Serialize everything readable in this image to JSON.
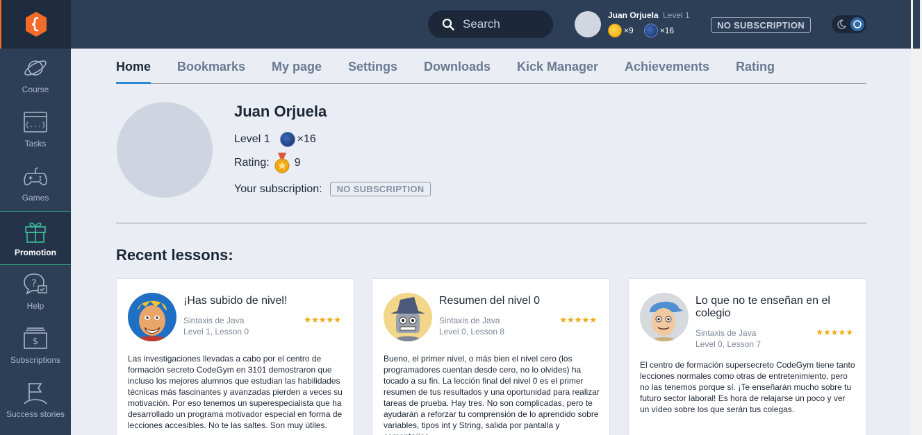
{
  "sidebar": {
    "logo": "codegym-logo",
    "items": [
      {
        "label": "Course",
        "icon": "planet-icon"
      },
      {
        "label": "Tasks",
        "icon": "code-braces-icon"
      },
      {
        "label": "Games",
        "icon": "gamepad-icon"
      },
      {
        "label": "Promotion",
        "icon": "gift-icon"
      },
      {
        "label": "Help",
        "icon": "help-chat-icon"
      },
      {
        "label": "Subscriptions",
        "icon": "dollar-bill-icon"
      },
      {
        "label": "Success stories",
        "icon": "flag-icon"
      }
    ]
  },
  "header": {
    "search_placeholder": "Search",
    "user_name": "Juan Orjuela",
    "user_level": "Level 1",
    "gold_count": "×9",
    "dark_count": "×16",
    "subscription_badge": "NO SUBSCRIPTION"
  },
  "tabs": [
    "Home",
    "Bookmarks",
    "My page",
    "Settings",
    "Downloads",
    "Kick Manager",
    "Achievements",
    "Rating"
  ],
  "profile": {
    "name": "Juan Orjuela",
    "level_label": "Level 1",
    "dark_count": "×16",
    "rating_label": "Rating:",
    "rating_value": "9",
    "subscription_label": "Your subscription:",
    "subscription_value": "NO SUBSCRIPTION"
  },
  "recent_title": "Recent lessons:",
  "lessons": [
    {
      "title": "¡Has subido de nivel!",
      "course": "Sintaxis de Java",
      "lesson": "Level 1, Lesson 0",
      "rating": 4.5,
      "stars": "★★★★★",
      "body": "Las investigaciones llevadas a cabo por el centro de formación secreto CodeGym en 3101 demostraron que incluso los mejores alumnos que estudian las habilidades técnicas más fascinantes y avanzadas pierden a veces su motivación. Por eso tenemos un superespecialista que ha desarrollado un programa motivador especial en forma de lecciones accesibles. No te las saltes. Son muy útiles."
    },
    {
      "title": "Resumen del nivel 0",
      "course": "Sintaxis de Java",
      "lesson": "Level 0, Lesson 8",
      "rating": 4.5,
      "stars": "★★★★★",
      "body": "Bueno, el primer nivel, o más bien el nivel cero (los programadores cuentan desde cero, no lo olvides) ha tocado a su fin. La lección final del nivel 0 es el primer resumen de tus resultados y una oportunidad para realizar tareas de prueba. Hay tres. No son complicadas, pero te ayudarán a reforzar tu comprensión de lo aprendido sobre variables, tipos int y String, salida por pantalla y comentarios."
    },
    {
      "title": "Lo que no te enseñan en el colegio",
      "course": "Sintaxis de Java",
      "lesson": "Level 0, Lesson 7",
      "rating": 5,
      "stars": "★★★★★",
      "body": "El centro de formación supersecreto CodeGym tiene tanto lecciones normales como otras de entretenimiento, pero no las tenemos porque sí. ¡Te enseñarán mucho sobre tu futuro sector laboral! Es hora de relajarse un poco y ver un vídeo sobre los que serán tus colegas."
    }
  ],
  "colors": {
    "sidebar_bg": "#2d3e57",
    "page_bg": "#eaedf4",
    "accent_tab": "#2b8ad6",
    "star": "#f0a912",
    "logo": "#f26b2a"
  }
}
